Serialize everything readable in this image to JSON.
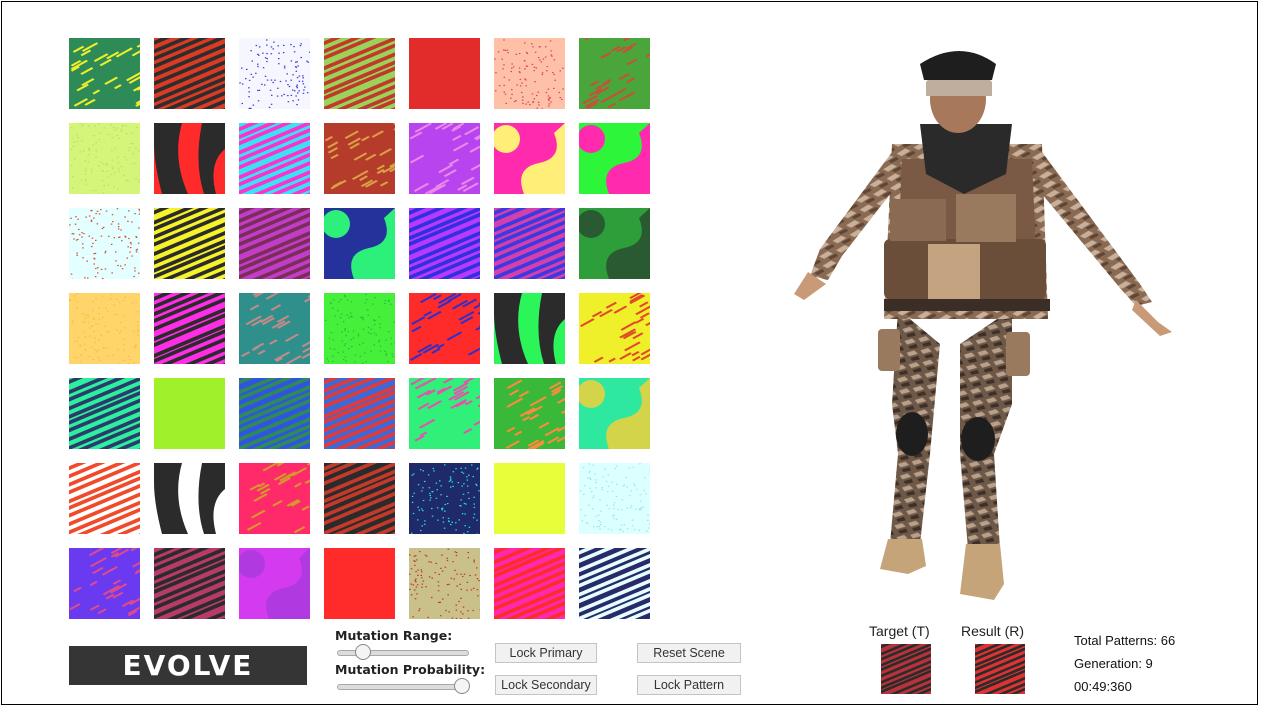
{
  "tiles": [
    {
      "bg": "#2e8b57",
      "fg": "#f0ef2a",
      "p": "streak"
    },
    {
      "bg": "#d93b24",
      "fg": "#2d2d2d",
      "p": "stripes"
    },
    {
      "bg": "#f6f6ff",
      "fg": "#3b3bd6",
      "p": "speck"
    },
    {
      "bg": "#9bd35a",
      "fg": "#c0392b",
      "p": "stripes"
    },
    {
      "bg": "#e22b2b",
      "fg": "#e22b2b",
      "p": "solid"
    },
    {
      "bg": "#ffc0a8",
      "fg": "#e0405a",
      "p": "speck"
    },
    {
      "bg": "#4aa63a",
      "fg": "#c84f3a",
      "p": "streak"
    },
    {
      "bg": "#d4f47a",
      "fg": "#b8df60",
      "p": "speck"
    },
    {
      "bg": "#ff2a2a",
      "fg": "#2b2b2b",
      "p": "bands"
    },
    {
      "bg": "#3ae3f0",
      "fg": "#ff2fd0",
      "p": "stripes"
    },
    {
      "bg": "#b53b2a",
      "fg": "#d9a046",
      "p": "streak"
    },
    {
      "bg": "#b844f0",
      "fg": "#e98ae8",
      "p": "streak"
    },
    {
      "bg": "#ff2aae",
      "fg": "#ffef78",
      "p": "blobs"
    },
    {
      "bg": "#2cf53a",
      "fg": "#ff2aae",
      "p": "blobs"
    },
    {
      "bg": "#e4ffff",
      "fg": "#e04a2a",
      "p": "speck"
    },
    {
      "bg": "#f6f32a",
      "fg": "#2b2b2b",
      "p": "stripes"
    },
    {
      "bg": "#c13dc7",
      "fg": "#7b2d5a",
      "p": "stripes"
    },
    {
      "bg": "#26329b",
      "fg": "#2cf07a",
      "p": "blobs"
    },
    {
      "bg": "#b83aff",
      "fg": "#3030e0",
      "p": "stripes"
    },
    {
      "bg": "#d43fae",
      "fg": "#3a3ae0",
      "p": "stripes"
    },
    {
      "bg": "#2e9e3a",
      "fg": "#2a5a32",
      "p": "blobs"
    },
    {
      "bg": "#ffd46a",
      "fg": "#f0c040",
      "p": "speck"
    },
    {
      "bg": "#ff2ee6",
      "fg": "#2b2b2b",
      "p": "stripes"
    },
    {
      "bg": "#2f8f8a",
      "fg": "#c48a8a",
      "p": "streak"
    },
    {
      "bg": "#46f03a",
      "fg": "#2cb83a",
      "p": "speck"
    },
    {
      "bg": "#ff2a2a",
      "fg": "#3030c8",
      "p": "streak"
    },
    {
      "bg": "#2cf55a",
      "fg": "#2b2b2b",
      "p": "bands"
    },
    {
      "bg": "#f0f02a",
      "fg": "#e04a2a",
      "p": "streak"
    },
    {
      "bg": "#2cf0a0",
      "fg": "#2b3b6a",
      "p": "stripes"
    },
    {
      "bg": "#a0f02a",
      "fg": "#a0f02a",
      "p": "solid"
    },
    {
      "bg": "#3054e0",
      "fg": "#2e8b57",
      "p": "stripes"
    },
    {
      "bg": "#3b6ad8",
      "fg": "#e03a3a",
      "p": "stripes"
    },
    {
      "bg": "#30f07a",
      "fg": "#e84fae",
      "p": "streak"
    },
    {
      "bg": "#3ab83a",
      "fg": "#ff8a3a",
      "p": "streak"
    },
    {
      "bg": "#2ee8a0",
      "fg": "#d4d44a",
      "p": "blobs"
    },
    {
      "bg": "#ffffff",
      "fg": "#f04a2a",
      "p": "stripes"
    },
    {
      "bg": "#ffffff",
      "fg": "#2b2b2b",
      "p": "bands"
    },
    {
      "bg": "#ff2a6a",
      "fg": "#d49a2a",
      "p": "streak"
    },
    {
      "bg": "#2b2b2b",
      "fg": "#c43a2a",
      "p": "stripes"
    },
    {
      "bg": "#1e2a6a",
      "fg": "#2ae0e0",
      "p": "speck"
    },
    {
      "bg": "#e6ff3a",
      "fg": "#e6ff3a",
      "p": "solid"
    },
    {
      "bg": "#dcffff",
      "fg": "#9ae6e6",
      "p": "speck"
    },
    {
      "bg": "#6a3af0",
      "fg": "#e04a8a",
      "p": "streak"
    },
    {
      "bg": "#b83a6a",
      "fg": "#2b2b2b",
      "p": "stripes"
    },
    {
      "bg": "#d43af0",
      "fg": "#b03ae0",
      "p": "blobs"
    },
    {
      "bg": "#ff2a2a",
      "fg": "#ff2a2a",
      "p": "solid"
    },
    {
      "bg": "#c9c08a",
      "fg": "#c0392b",
      "p": "speck"
    },
    {
      "bg": "#ff2aae",
      "fg": "#ff2a2a",
      "p": "stripes"
    },
    {
      "bg": "#2a2a6a",
      "fg": "#e4ffff",
      "p": "stripes"
    }
  ],
  "evolve_label": "EVOLVE",
  "mutation_range": {
    "label": "Mutation Range:",
    "value": 0.2
  },
  "mutation_probability": {
    "label": "Mutation Probability:",
    "value": 0.95
  },
  "buttons": {
    "lock_primary": "Lock Primary",
    "lock_secondary": "Lock Secondary",
    "reset_scene": "Reset Scene",
    "lock_pattern": "Lock Pattern"
  },
  "target": {
    "label": "Target (T)",
    "color": "#b8323a"
  },
  "result": {
    "label": "Result (R)",
    "color": "#e03232"
  },
  "stats": {
    "total_patterns": "Total Patterns: 66",
    "generation": "Generation: 9",
    "timer": "00:49:360"
  }
}
